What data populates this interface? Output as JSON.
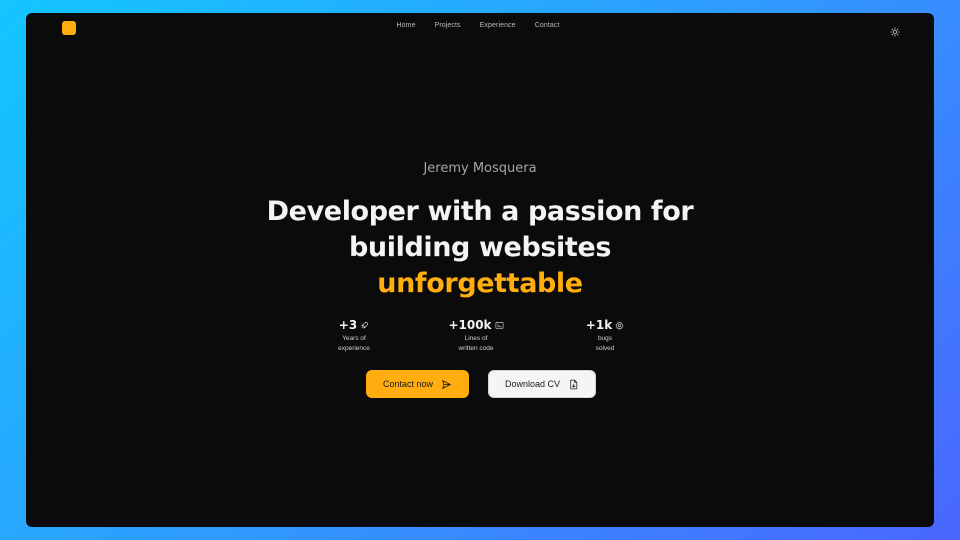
{
  "nav": {
    "items": [
      {
        "label": "Home"
      },
      {
        "label": "Projects"
      },
      {
        "label": "Experience"
      },
      {
        "label": "Contact"
      }
    ]
  },
  "hero": {
    "name": "Jeremy Mosquera",
    "headline_line1": "Developer with a passion for",
    "headline_line2": "building websites",
    "headline_accent": "unforgettable"
  },
  "stats": [
    {
      "value": "+3",
      "label_line1": "Years of",
      "label_line2": "experience",
      "icon": "rocket-icon"
    },
    {
      "value": "+100k",
      "label_line1": "Lines of",
      "label_line2": "written code",
      "icon": "terminal-icon"
    },
    {
      "value": "+1k",
      "label_line1": "bugs",
      "label_line2": "solved",
      "icon": "gear-icon"
    }
  ],
  "actions": {
    "contact_label": "Contact now",
    "download_label": "Download CV"
  },
  "colors": {
    "accent": "#ffad0f",
    "window_bg": "#0b0b0c",
    "text_primary": "#f4f4f4",
    "text_muted": "#a6a6a6"
  }
}
